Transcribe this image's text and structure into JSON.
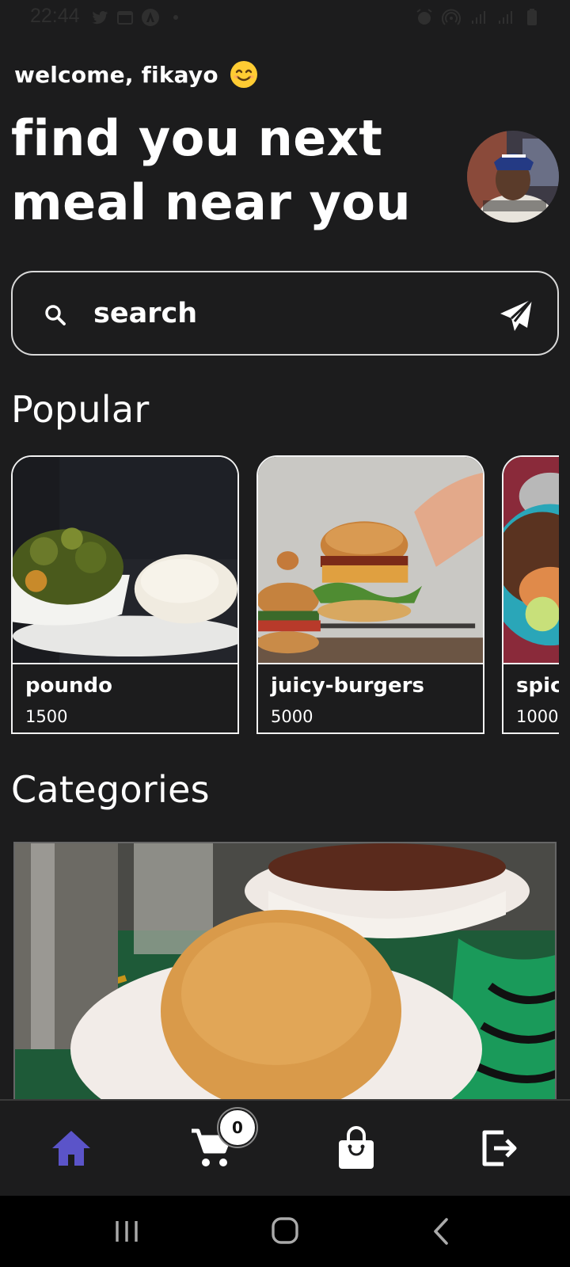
{
  "status_bar": {
    "time": "22:44",
    "icons": [
      "twitter-icon",
      "calendar-icon",
      "app-icon",
      "dot-icon",
      "alarm-icon",
      "hotspot-icon",
      "signal-icon",
      "signal-icon",
      "battery-icon"
    ]
  },
  "header": {
    "welcome": "welcome, fikayo",
    "emoji_icon": "smiling-face-icon",
    "headline_line1": "find you next",
    "headline_line2": "meal near you"
  },
  "search": {
    "placeholder": "search",
    "value": ""
  },
  "popular": {
    "title": "Popular",
    "items": [
      {
        "name": "poundo",
        "price": "1500"
      },
      {
        "name": "juicy-burgers",
        "price": "5000"
      },
      {
        "name": "spicy",
        "price": "1000"
      }
    ]
  },
  "categories": {
    "title": "Categories"
  },
  "bottom_nav": {
    "items": [
      "home-icon",
      "cart-icon",
      "shopping-bag-icon",
      "logout-icon"
    ],
    "cart_count": "0",
    "active_color": "#5b54c9"
  },
  "colors": {
    "background": "#1c1c1d",
    "text": "#ffffff",
    "accent": "#5b54c9"
  }
}
